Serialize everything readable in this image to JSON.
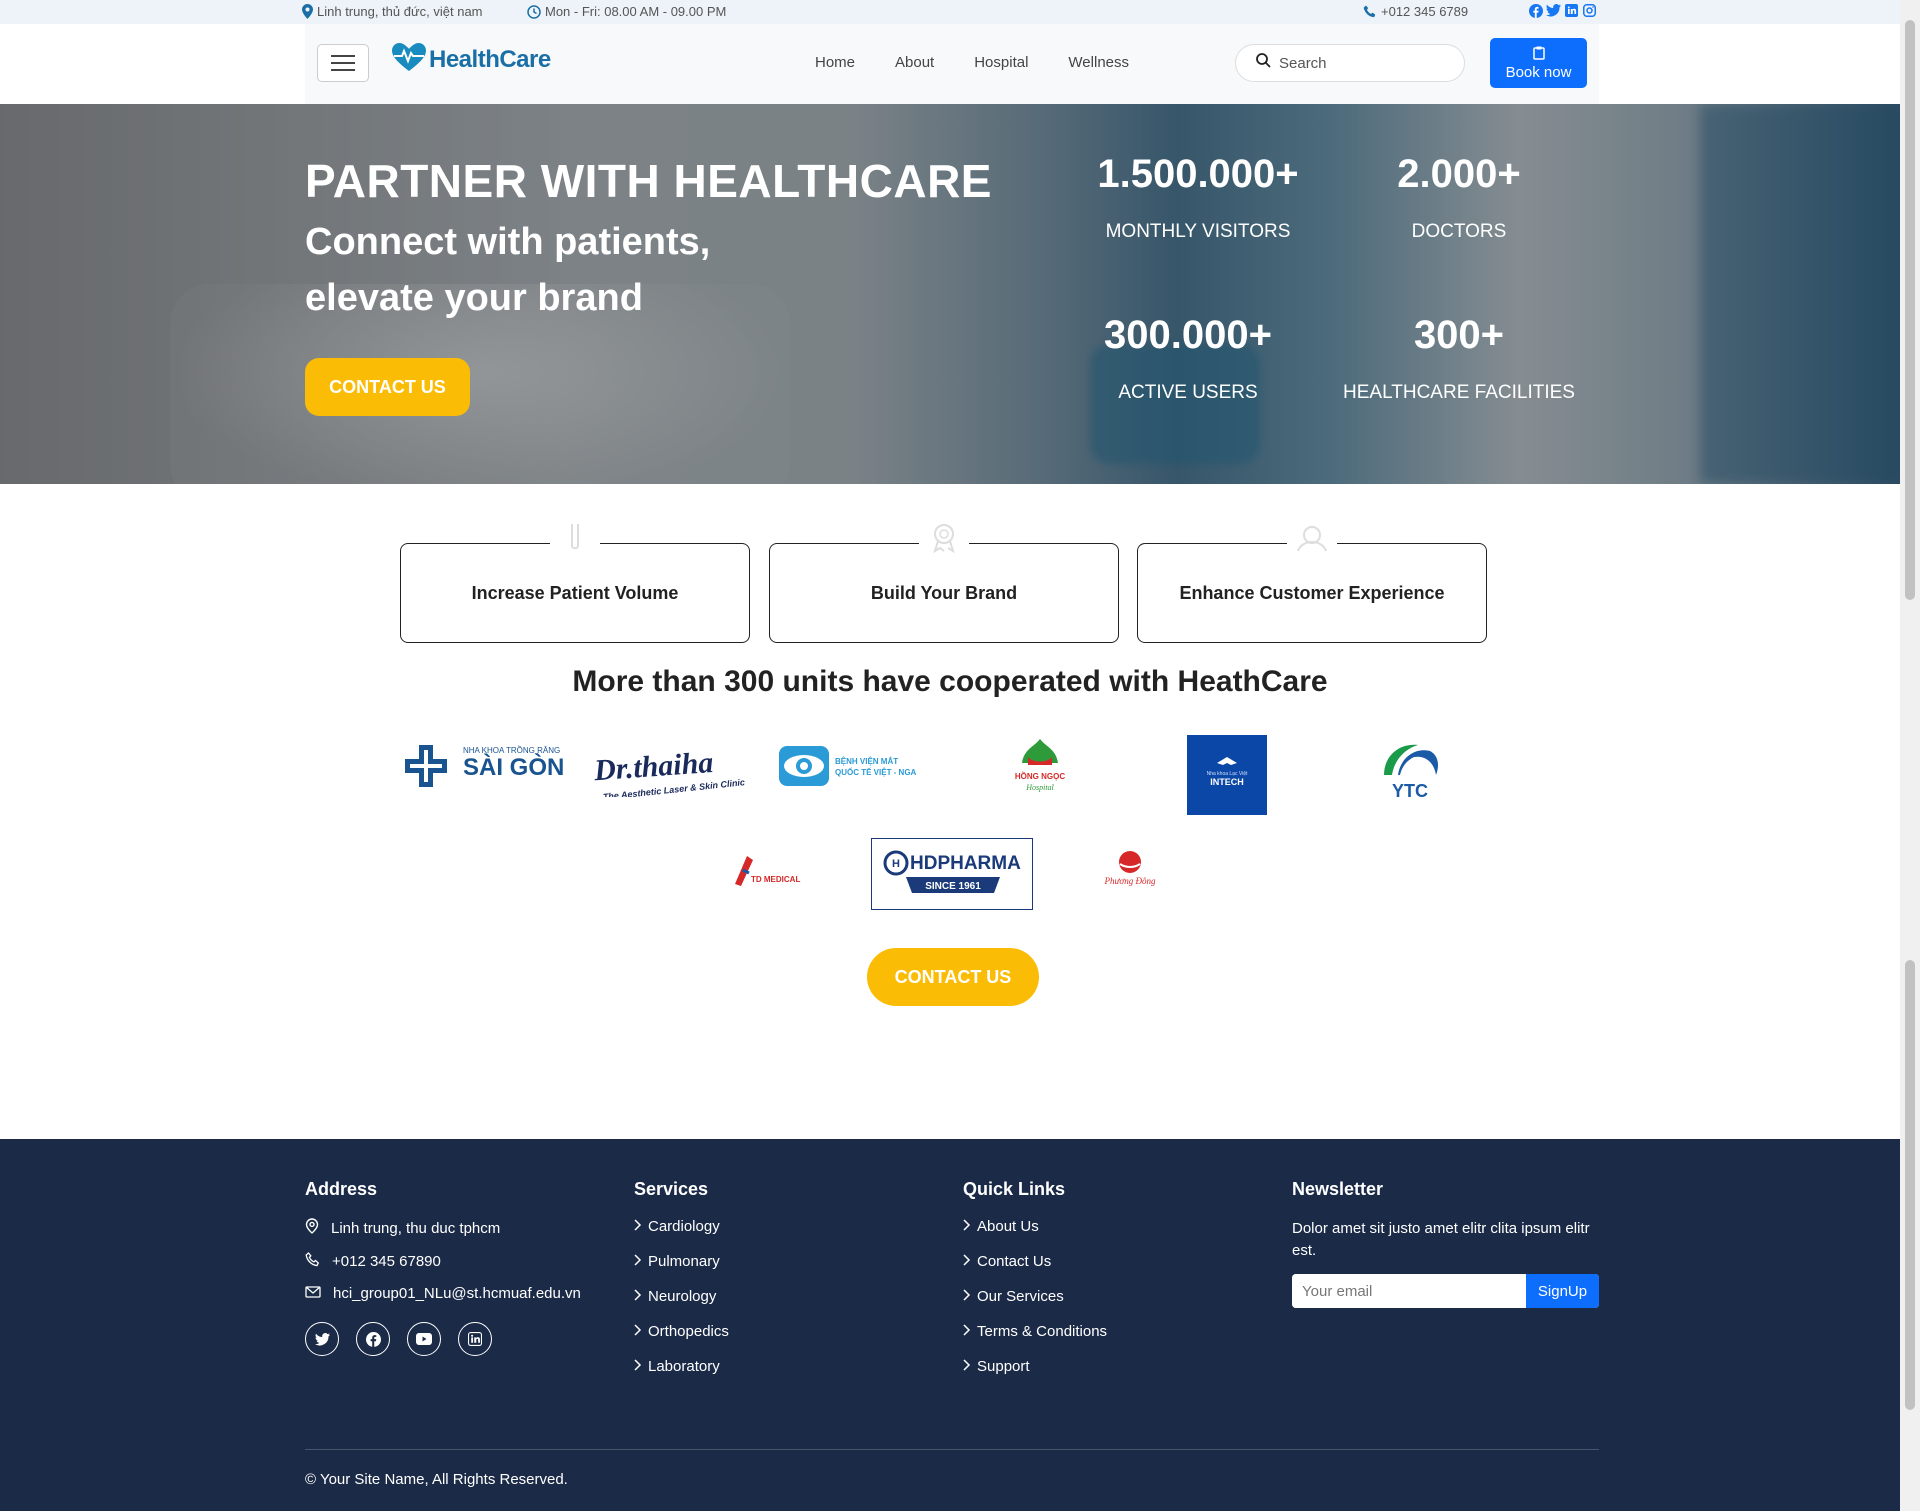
{
  "topbar": {
    "address": "Linh trung, thủ đức, việt nam",
    "hours": "Mon - Fri: 08.00 AM - 09.00 PM",
    "phone": "+012 345 6789"
  },
  "nav": {
    "logo": "HealthCare",
    "links": [
      "Home",
      "About",
      "Hospital",
      "Wellness"
    ],
    "search_placeholder": "Search",
    "book_label": "Book now"
  },
  "hero": {
    "title": "PARTNER WITH HEALTHCARE",
    "subtitle": "Connect with patients, elevate your brand",
    "cta": "CONTACT US",
    "stats": [
      {
        "value": "1.500.000+",
        "label": "MONTHLY VISITORS"
      },
      {
        "value": "2.000+",
        "label": "DOCTORS"
      },
      {
        "value": "300.000+",
        "label": "ACTIVE USERS"
      },
      {
        "value": "300+",
        "label": "HEALTHCARE FACILITIES"
      }
    ]
  },
  "features": [
    "Increase Patient Volume",
    "Build Your Brand",
    "Enhance Customer Experience"
  ],
  "partners": {
    "title": "More than 300 units have cooperated with HeathCare",
    "logos": [
      {
        "main": "SÀI GÒN",
        "small": "NHA KHOA TRỒNG RĂNG"
      },
      {
        "main": "Dr.thaiha",
        "small": "The Aesthetic Laser & Skin Clinic"
      },
      {
        "main": "BỆNH VIỆN MẮT",
        "small": "QUỐC TẾ VIỆT - NGA"
      },
      {
        "main": "HỒNG NGỌC",
        "small": "Hospital"
      },
      {
        "main": "INTECH",
        "small": "Nha khoa Lạc Việt"
      },
      {
        "main": "YTC",
        "small": ""
      },
      {
        "main": "TD MEDICAL",
        "small": ""
      },
      {
        "main": "HDPHARMA",
        "small": "SINCE 1961"
      },
      {
        "main": "Phương Đông",
        "small": ""
      }
    ],
    "cta": "CONTACT US"
  },
  "footer": {
    "address_title": "Address",
    "address": "Linh trung, thu duc tphcm",
    "phone": "+012 345 67890",
    "email": "hci_group01_NLu@st.hcmuaf.edu.vn",
    "services_title": "Services",
    "services": [
      "Cardiology",
      "Pulmonary",
      "Neurology",
      "Orthopedics",
      "Laboratory"
    ],
    "links_title": "Quick Links",
    "links": [
      "About Us",
      "Contact Us",
      "Our Services",
      "Terms & Conditions",
      "Support"
    ],
    "newsletter_title": "Newsletter",
    "newsletter_text": "Dolor amet sit justo amet elitr clita ipsum elitr est.",
    "email_placeholder": "Your email",
    "signup": "SignUp",
    "copyright": "© Your Site Name, All Rights Reserved."
  },
  "colors": {
    "primary": "#0d6efd",
    "accent": "#fbbc05",
    "footer_bg": "#1b2a47",
    "logo": "#1a6fa6"
  }
}
